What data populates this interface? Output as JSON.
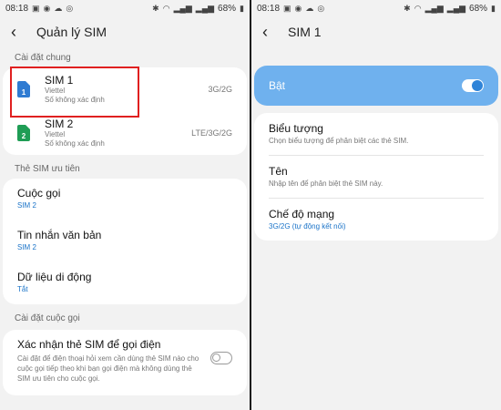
{
  "status": {
    "time": "08:18",
    "battery": "68%"
  },
  "left": {
    "title": "Quản lý SIM",
    "general_header": "Cài đặt chung",
    "sims": [
      {
        "name": "SIM 1",
        "carrier": "Viettel",
        "number": "Số không xác định",
        "network": "3G/2G",
        "badge": "1",
        "color": "#2f7bd2"
      },
      {
        "name": "SIM 2",
        "carrier": "Viettel",
        "number": "Số không xác định",
        "network": "LTE/3G/2G",
        "badge": "2",
        "color": "#1f9d55"
      }
    ],
    "preferred_header": "Thẻ SIM ưu tiên",
    "preferred": [
      {
        "title": "Cuộc gọi",
        "value": "SIM 2"
      },
      {
        "title": "Tin nhắn văn bản",
        "value": "SIM 2"
      },
      {
        "title": "Dữ liệu di động",
        "value": "Tắt"
      }
    ],
    "call_header": "Cài đặt cuộc gọi",
    "confirm_title": "Xác nhận thẻ SIM để gọi điện",
    "confirm_desc": "Cài đặt để điện thoại hỏi xem cần dùng thẻ SIM nào cho cuộc gọi tiếp theo khi bạn gọi điện mà không dùng thẻ SIM ưu tiên cho cuộc gọi."
  },
  "right": {
    "title": "SIM 1",
    "master_label": "Bật",
    "settings": [
      {
        "title": "Biểu tượng",
        "desc": "Chọn biểu tượng để phân biệt các thẻ SIM."
      },
      {
        "title": "Tên",
        "desc": "Nhập tên để phân biệt thẻ SIM này."
      },
      {
        "title": "Chế độ mạng",
        "value": "3G/2G (tự động kết nối)"
      }
    ]
  }
}
